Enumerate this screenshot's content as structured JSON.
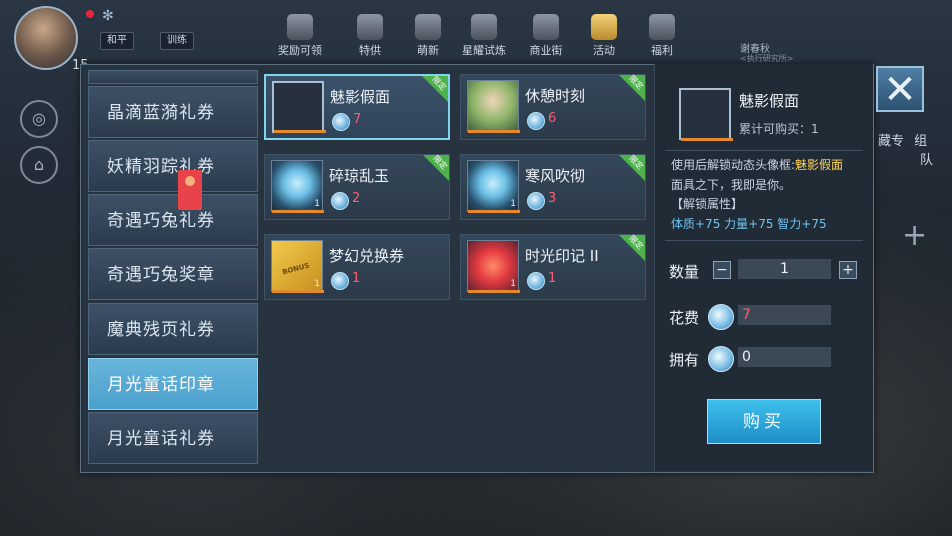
{
  "hud": {
    "level": "15",
    "chips": [
      "和平",
      "训练"
    ],
    "top_icons": [
      {
        "label": "奖励可领",
        "icon": "download-icon"
      },
      {
        "label": "特供",
        "icon": "gift-box-icon"
      },
      {
        "label": "萌新",
        "icon": "gift-icon"
      },
      {
        "label": "星耀试炼",
        "icon": "trial-icon"
      },
      {
        "label": "商业街",
        "icon": "shop-icon"
      },
      {
        "label": "活动",
        "icon": "diamond-icon"
      },
      {
        "label": "福利",
        "icon": "welfare-icon"
      }
    ],
    "right_text_1": "谢春秋",
    "right_text_2": "<执行研究所>",
    "right_far": [
      "藏专",
      "组",
      "队"
    ]
  },
  "sidebar": {
    "items": [
      {
        "label": "晶滴蓝漪礼券"
      },
      {
        "label": "妖精羽踪礼券"
      },
      {
        "label": "奇遇巧兔礼券"
      },
      {
        "label": "奇遇巧兔奖章"
      },
      {
        "label": "魔典残页礼券"
      },
      {
        "label": "月光童话印章",
        "active": true
      },
      {
        "label": "月光童话礼券"
      }
    ]
  },
  "items": [
    {
      "name": "魅影假面",
      "price": "7",
      "limited": true,
      "count": "",
      "selected": true,
      "art": "frame"
    },
    {
      "name": "休憩时刻",
      "price": "6",
      "limited": true,
      "count": "",
      "art": "portrait"
    },
    {
      "name": "碎琼乱玉",
      "price": "2",
      "limited": true,
      "count": "1",
      "art": "gem"
    },
    {
      "name": "寒风吹彻",
      "price": "3",
      "limited": true,
      "count": "1",
      "art": "gem"
    },
    {
      "name": "梦幻兑换券",
      "price": "1",
      "limited": false,
      "count": "1",
      "art": "ticket"
    },
    {
      "name": "时光印记 II",
      "price": "1",
      "limited": true,
      "count": "1",
      "art": "stamp"
    }
  ],
  "limited_tag": "限定",
  "bonus_text": "BONUS",
  "detail": {
    "name": "魅影假面",
    "limit_text": "累计可购买：1",
    "desc_prefix": "使用后解锁动态头像框:",
    "desc_highlight": "魅影假面",
    "desc_line2": "面具之下，我即是你。",
    "desc_line3": "【解锁属性】",
    "desc_line4": "体质+75 力量+75 智力+75",
    "qty_label": "数量",
    "qty_value": "1",
    "minus": "−",
    "plus": "+",
    "cost_label": "花费",
    "cost_value": "7",
    "own_label": "拥有",
    "own_value": "0",
    "buy_label": "购买"
  },
  "colors": {
    "accent": "#4aa0cc",
    "price_red": "#ff5d74",
    "limited_green": "#4db24a",
    "highlight_yellow": "#ffd55c"
  }
}
